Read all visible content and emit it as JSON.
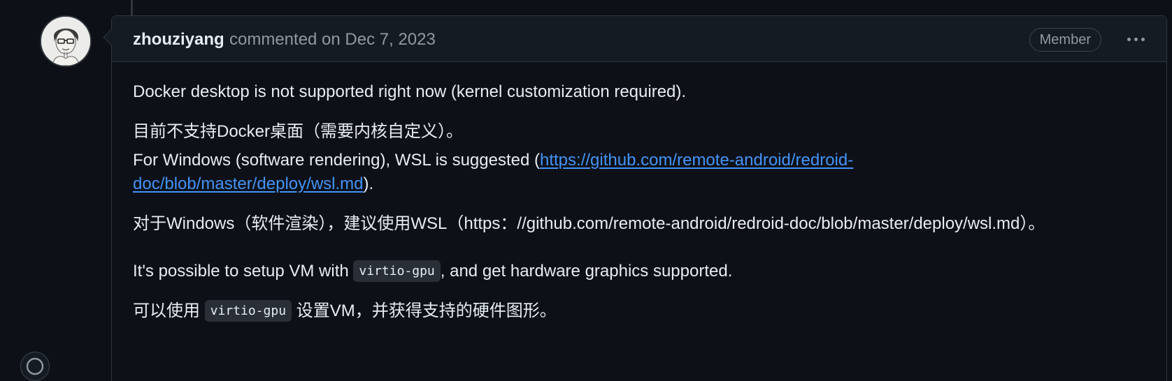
{
  "comment": {
    "author": "zhouziyang",
    "meta": "commented on Dec 7, 2023",
    "badge": "Member",
    "icons": {
      "avatar": "user-avatar",
      "menu": "kebab-horizontal-icon",
      "reaction": "smiley-icon"
    },
    "lines": {
      "l1": "Docker desktop is not supported right now (kernel customization required).",
      "l2": "目前不支持Docker桌面（需要内核自定义）。",
      "l3_prefix": "For Windows (software rendering), WSL is suggested (",
      "l3_link_part1": "https://github.com/remote-android/redroid-",
      "l4_link_part2": "doc/blob/master/deploy/wsl.md",
      "l4_suffix": ").",
      "l5": "对于Windows（软件渲染），建议使用WSL（https：//github.com/remote-android/redroid-doc/blob/master/deploy/wsl.md）。",
      "l6_prefix": "It's possible to setup VM with ",
      "l6_code": "virtio-gpu",
      "l6_suffix": ", and get hardware graphics supported.",
      "l7_prefix": "可以使用 ",
      "l7_code": "virtio-gpu",
      "l7_suffix": " 设置VM，并获得支持的硬件图形。"
    }
  },
  "colors": {
    "background": "#0d1117",
    "header": "#151b23",
    "border": "#30363d",
    "text": "#e6edf3",
    "muted": "#9198a1",
    "link": "#4493f8"
  }
}
